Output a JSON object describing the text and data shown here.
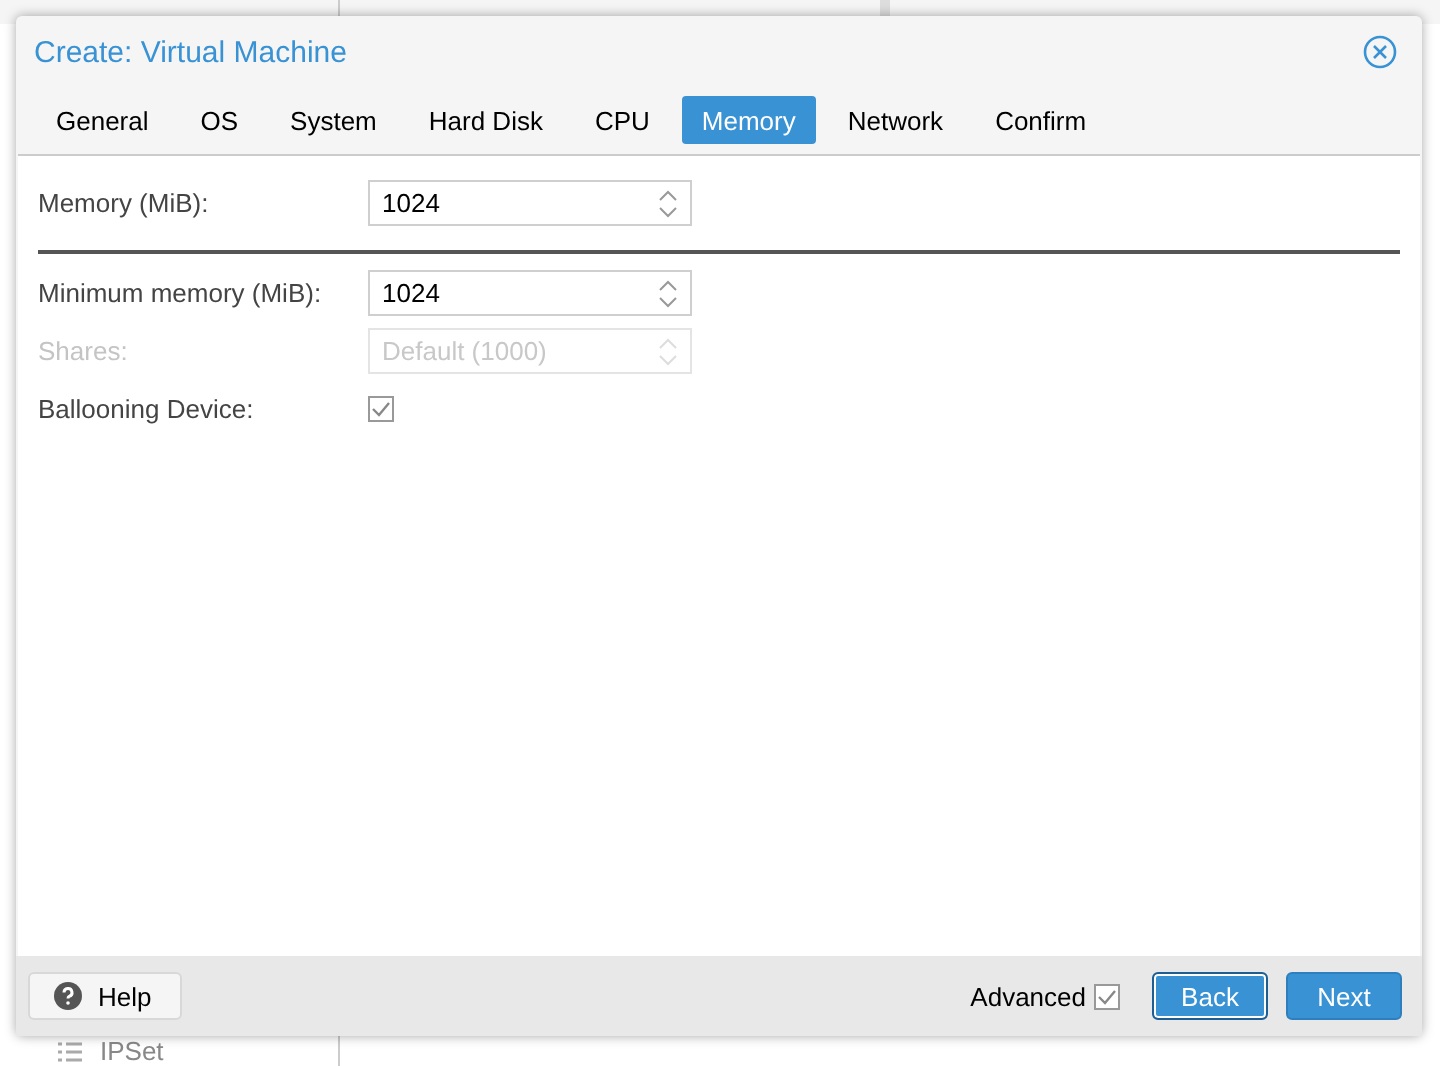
{
  "background": {
    "sidebar_items": [
      {
        "label": "IPSet",
        "kind": "list"
      }
    ]
  },
  "dialog": {
    "title": "Create: Virtual Machine",
    "tabs": [
      {
        "label": "General",
        "selected": false
      },
      {
        "label": "OS",
        "selected": false
      },
      {
        "label": "System",
        "selected": false
      },
      {
        "label": "Hard Disk",
        "selected": false
      },
      {
        "label": "CPU",
        "selected": false
      },
      {
        "label": "Memory",
        "selected": true
      },
      {
        "label": "Network",
        "selected": false
      },
      {
        "label": "Confirm",
        "selected": false
      }
    ],
    "fields": [
      {
        "kind": "spinner",
        "label": "Memory (MiB):",
        "value": "1024",
        "disabled": false
      },
      {
        "kind": "separator"
      },
      {
        "kind": "spinner",
        "label": "Minimum memory (MiB):",
        "value": "1024",
        "disabled": false
      },
      {
        "kind": "spinner",
        "label": "Shares:",
        "placeholder": "Default (1000)",
        "disabled": true
      },
      {
        "kind": "checkbox",
        "label": "Ballooning Device:",
        "checked": true,
        "disabled": false
      }
    ],
    "footer": {
      "help": "Help",
      "advanced": {
        "label": "Advanced",
        "checked": true
      },
      "buttons": [
        {
          "label": "Back",
          "focused": true
        },
        {
          "label": "Next",
          "focused": false
        }
      ]
    }
  }
}
